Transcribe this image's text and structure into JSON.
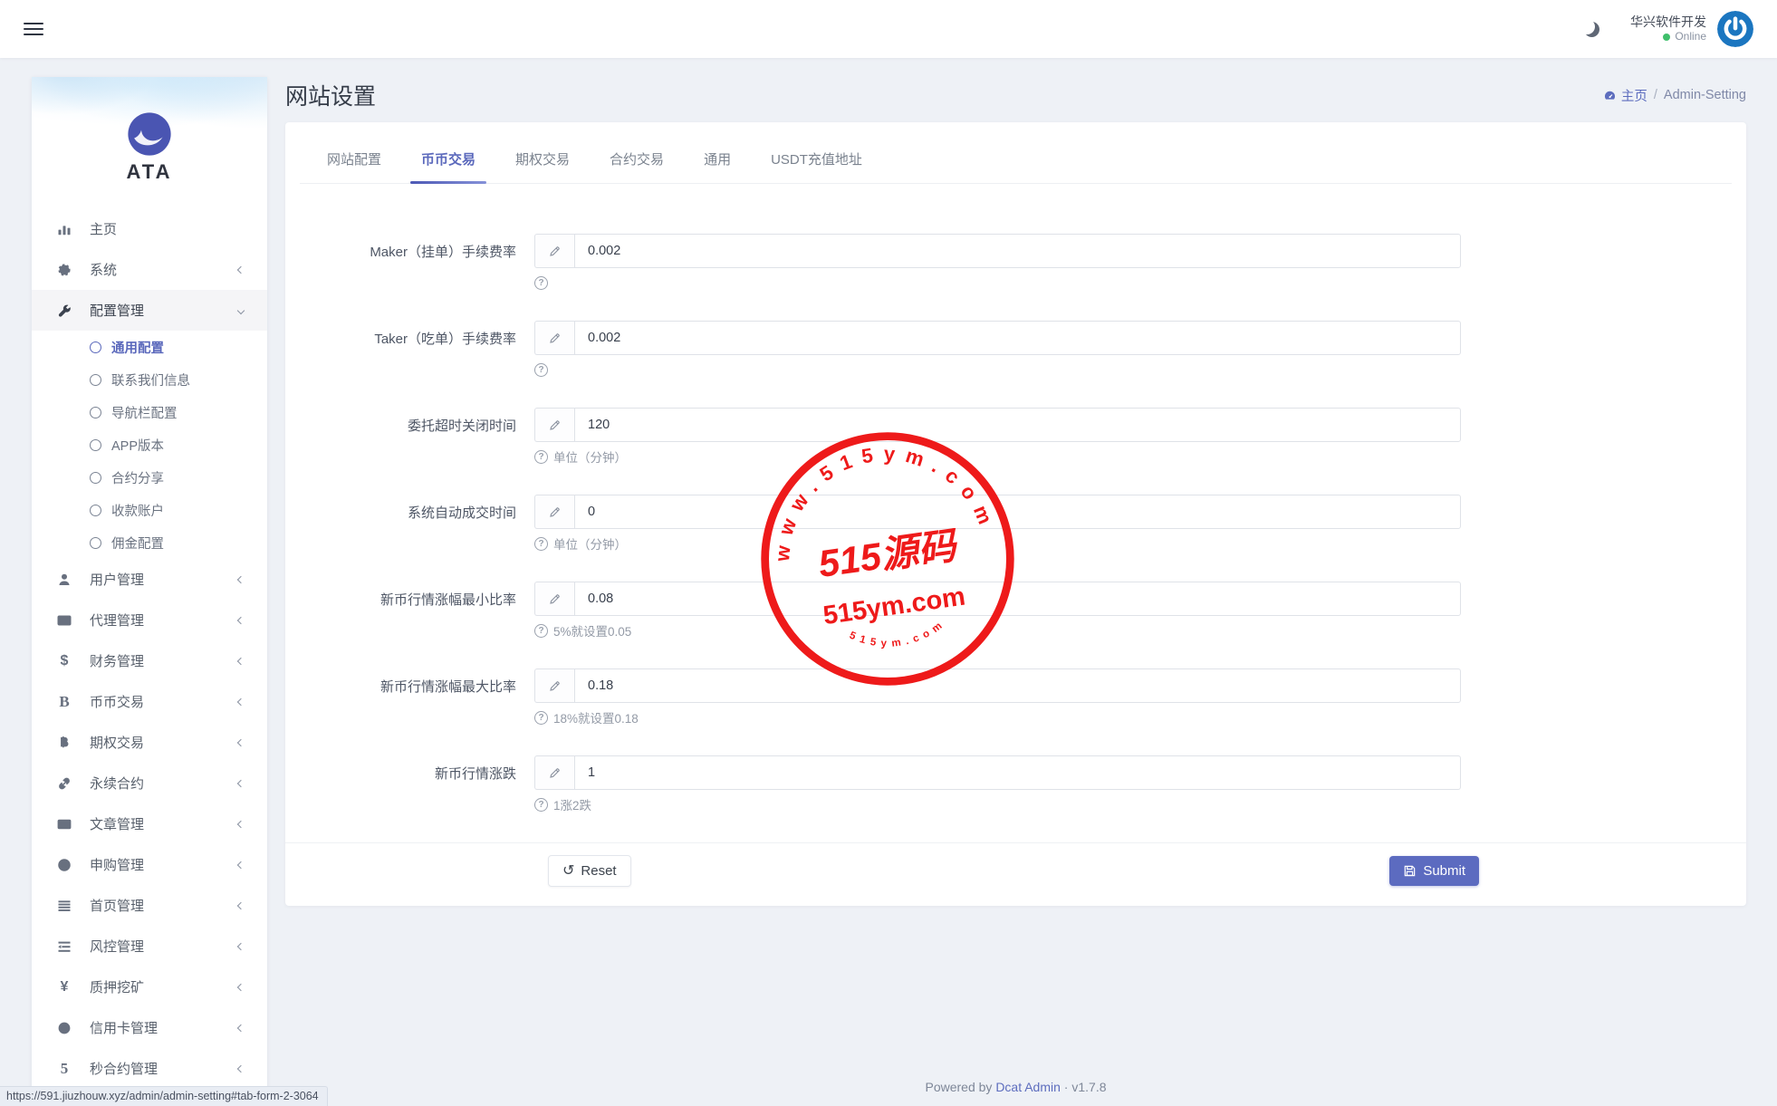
{
  "colors": {
    "accent": "#5c6bc0",
    "stamp_red": "#ee1111",
    "online_green": "#3fbf6b",
    "avatar_blue": "#1b76c0"
  },
  "navbar": {
    "user_name": "华兴软件开发",
    "online_label": "Online"
  },
  "sidebar": {
    "logo_text": "ATA",
    "items": [
      {
        "id": "home",
        "icon": "chart-bar",
        "label": "主页"
      },
      {
        "id": "system",
        "icon": "gear",
        "label": "系统",
        "chevron": "left"
      },
      {
        "id": "config",
        "icon": "wrench",
        "label": "配置管理",
        "chevron": "down",
        "active": true,
        "children": [
          {
            "id": "general-config",
            "label": "通用配置",
            "active": true
          },
          {
            "id": "contact-info",
            "label": "联系我们信息"
          },
          {
            "id": "navbar-config",
            "label": "导航栏配置"
          },
          {
            "id": "app-version",
            "label": "APP版本"
          },
          {
            "id": "contract-share",
            "label": "合约分享"
          },
          {
            "id": "payment-account",
            "label": "收款账户"
          },
          {
            "id": "commission-config",
            "label": "佣金配置"
          }
        ]
      },
      {
        "id": "users",
        "icon": "user",
        "label": "用户管理",
        "chevron": "left"
      },
      {
        "id": "agents",
        "icon": "id-card",
        "label": "代理管理",
        "chevron": "left"
      },
      {
        "id": "finance",
        "icon": "dollar",
        "label": "财务管理",
        "chevron": "left"
      },
      {
        "id": "spot-trade",
        "icon": "b-serif",
        "label": "币币交易",
        "chevron": "left"
      },
      {
        "id": "options-trade",
        "icon": "bitcoin",
        "label": "期权交易",
        "chevron": "left"
      },
      {
        "id": "perpetual",
        "icon": "link",
        "label": "永续合约",
        "chevron": "left"
      },
      {
        "id": "articles",
        "icon": "newspaper",
        "label": "文章管理",
        "chevron": "left"
      },
      {
        "id": "subscription",
        "icon": "life-ring",
        "label": "申购管理",
        "chevron": "left"
      },
      {
        "id": "homepage",
        "icon": "bars",
        "label": "首页管理",
        "chevron": "left"
      },
      {
        "id": "risk-control",
        "icon": "stream",
        "label": "风控管理",
        "chevron": "left"
      },
      {
        "id": "staking",
        "icon": "yen",
        "label": "质押挖矿",
        "chevron": "left"
      },
      {
        "id": "credit-card",
        "icon": "circle",
        "label": "信用卡管理",
        "chevron": "left"
      },
      {
        "id": "second-contract",
        "icon": "five",
        "label": "秒合约管理",
        "chevron": "left"
      }
    ]
  },
  "page": {
    "title": "网站设置",
    "breadcrumb_home": "主页",
    "breadcrumb_sep": "/",
    "breadcrumb_current": "Admin-Setting"
  },
  "tabs": [
    {
      "id": "site-config",
      "label": "网站配置"
    },
    {
      "id": "spot",
      "label": "币币交易",
      "active": true
    },
    {
      "id": "options",
      "label": "期权交易"
    },
    {
      "id": "contract",
      "label": "合约交易"
    },
    {
      "id": "general",
      "label": "通用"
    },
    {
      "id": "usdt-address",
      "label": "USDT充值地址"
    }
  ],
  "form": {
    "fields": [
      {
        "id": "maker-fee",
        "label": "Maker（挂单）手续费率",
        "value": "0.002",
        "help": ""
      },
      {
        "id": "taker-fee",
        "label": "Taker（吃单）手续费率",
        "value": "0.002",
        "help": ""
      },
      {
        "id": "order-timeout",
        "label": "委托超时关闭时间",
        "value": "120",
        "help": "单位（分钟）"
      },
      {
        "id": "auto-deal-time",
        "label": "系统自动成交时间",
        "value": "0",
        "help": "单位（分钟）"
      },
      {
        "id": "min-rise-rate",
        "label": "新币行情涨幅最小比率",
        "value": "0.08",
        "help": "5%就设置0.05"
      },
      {
        "id": "max-rise-rate",
        "label": "新币行情涨幅最大比率",
        "value": "0.18",
        "help": "18%就设置0.18"
      },
      {
        "id": "rise-fall",
        "label": "新币行情涨跌",
        "value": "1",
        "help": "1涨2跌"
      }
    ],
    "reset_label": "Reset",
    "submit_label": "Submit"
  },
  "watermark": {
    "arc_top": "www.515ym.com",
    "center_line1": "515源码",
    "center_line2": "515ym.com",
    "arc_bottom": "515ym.com"
  },
  "footer": {
    "powered_by": "Powered by",
    "link_label": "Dcat Admin",
    "separator": "·",
    "version": "v1.7.8"
  },
  "statusbar": {
    "url": "https://591.jiuzhouw.xyz/admin/admin-setting#tab-form-2-3064"
  }
}
